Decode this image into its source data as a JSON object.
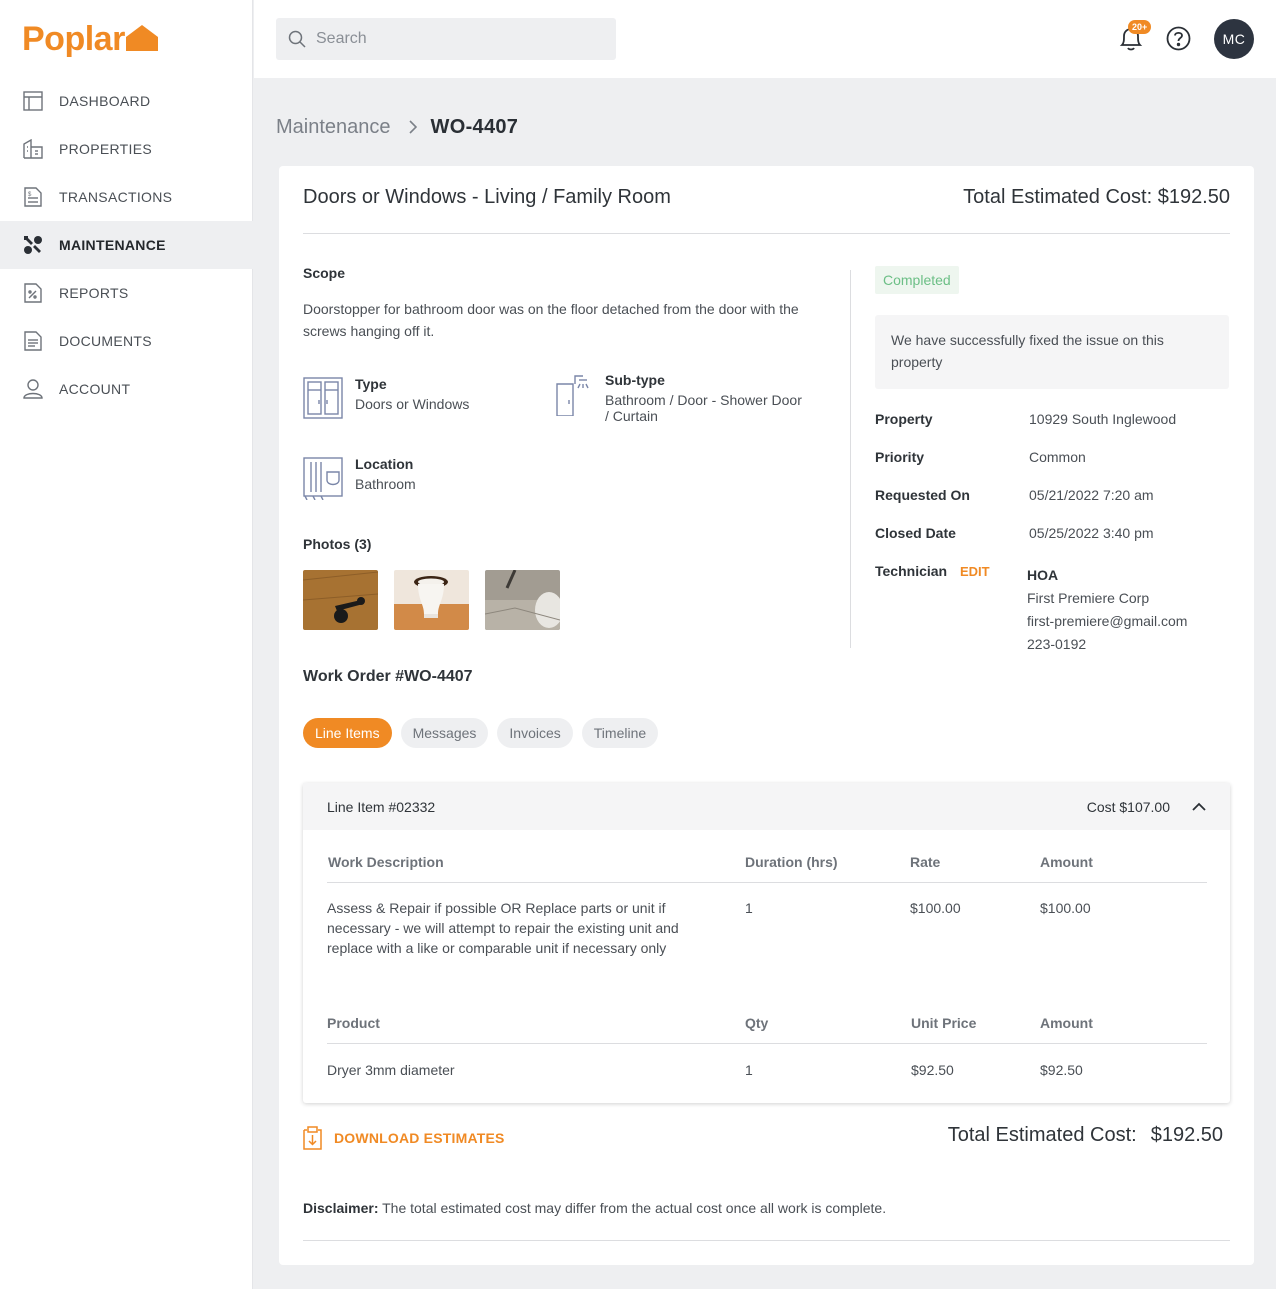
{
  "brand": {
    "name": "Poplar",
    "accent": "#f08a24"
  },
  "sidebar": {
    "items": [
      {
        "label": "DASHBOARD",
        "icon": "dashboard-icon"
      },
      {
        "label": "PROPERTIES",
        "icon": "building-icon"
      },
      {
        "label": "TRANSACTIONS",
        "icon": "receipt-icon"
      },
      {
        "label": "MAINTENANCE",
        "icon": "tools-icon",
        "active": true
      },
      {
        "label": "REPORTS",
        "icon": "report-icon"
      },
      {
        "label": "DOCUMENTS",
        "icon": "document-icon"
      },
      {
        "label": "ACCOUNT",
        "icon": "user-icon"
      }
    ]
  },
  "topbar": {
    "search_placeholder": "Search",
    "notification_count": "20+",
    "avatar_initials": "MC"
  },
  "breadcrumb": {
    "parent": "Maintenance",
    "current": "WO-4407"
  },
  "request": {
    "title": "Doors or Windows - Living / Family Room",
    "total_header": "Total Estimated Cost: $192.50",
    "scope_label": "Scope",
    "scope_text": "Doorstopper for bathroom door was on the floor detached from the door with the screws hanging off it.",
    "type_label": "Type",
    "type_value": "Doors or Windows",
    "subtype_label": "Sub-type",
    "subtype_value": "Bathroom / Door - Shower Door / Curtain",
    "location_label": "Location",
    "location_value": "Bathroom",
    "photos_label": "Photos (3)"
  },
  "status": {
    "badge": "Completed",
    "note": "We have successfully fixed the issue on this property",
    "property_label": "Property",
    "property": "10929 South Inglewood",
    "priority_label": "Priority",
    "priority": "Common",
    "requested_label": "Requested On",
    "requested": "05/21/2022 7:20 am",
    "closed_label": "Closed Date",
    "closed": "05/25/2022 3:40 pm",
    "technician_label": "Technician",
    "edit_label": "EDIT",
    "tech_type": "HOA",
    "tech_company": "First Premiere Corp",
    "tech_email": "first-premiere@gmail.com",
    "tech_phone": "223-0192"
  },
  "work_order": {
    "title": "Work Order #WO-4407",
    "tabs": [
      "Line Items",
      "Messages",
      "Invoices",
      "Timeline"
    ],
    "line_item": {
      "title": "Line Item #02332",
      "cost": "Cost $107.00",
      "work_headers": [
        "Work Description",
        "Duration (hrs)",
        "Rate",
        "Amount"
      ],
      "work_row": [
        "Assess & Repair if possible OR Replace parts or unit if necessary - we will attempt to repair the existing unit and replace with a like or comparable unit if necessary only",
        "1",
        "$100.00",
        "$100.00"
      ],
      "product_headers": [
        "Product",
        "Qty",
        "Unit Price",
        "Amount"
      ],
      "product_row": [
        "Dryer 3mm diameter",
        "1",
        "$92.50",
        "$92.50"
      ]
    },
    "download_label": "DOWNLOAD ESTIMATES",
    "total_label": "Total Estimated Cost:",
    "total_value": "$192.50",
    "disclaimer_label": "Disclaimer:",
    "disclaimer_text": " The total estimated cost may differ from the actual cost once all work is complete."
  }
}
